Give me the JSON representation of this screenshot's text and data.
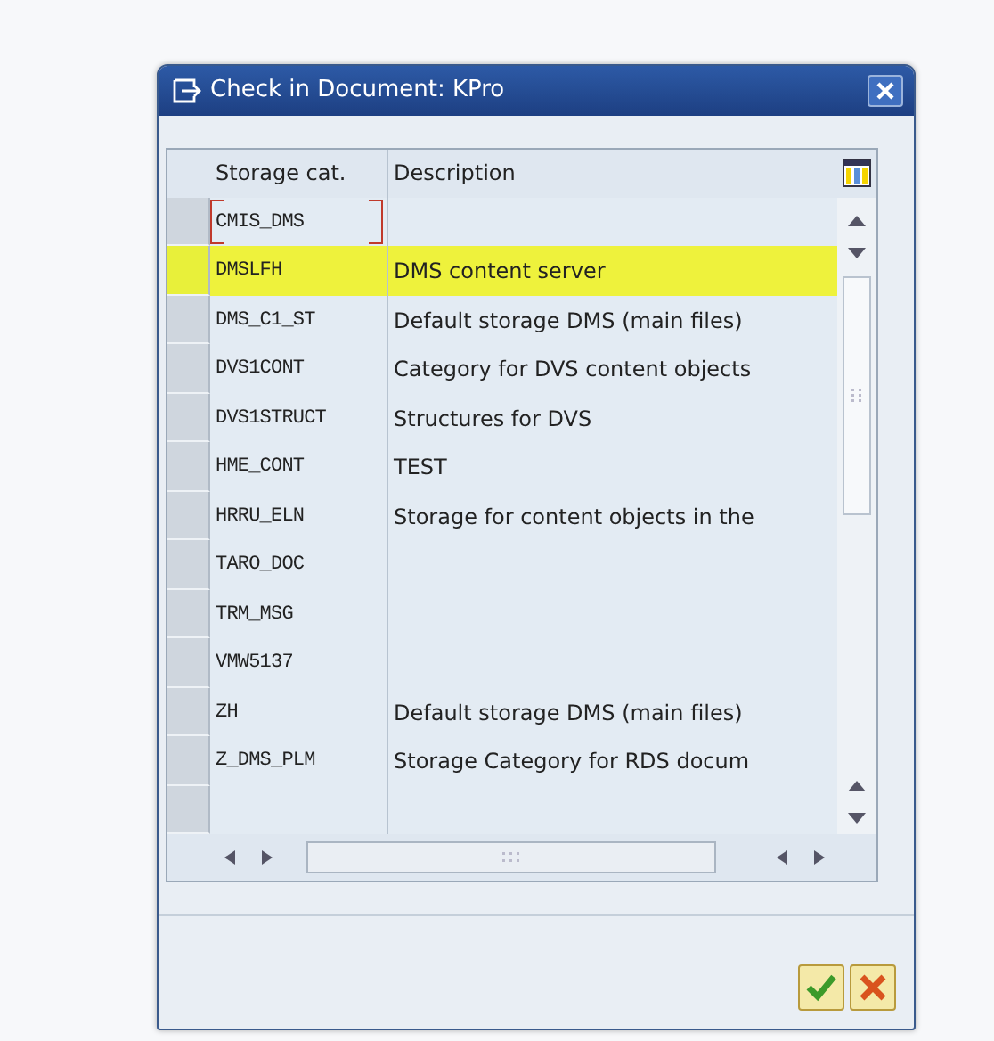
{
  "window": {
    "title": "Check in Document: KPro"
  },
  "table": {
    "columns": [
      "Storage cat.",
      "Description"
    ],
    "rows": [
      {
        "storage_cat": "CMIS_DMS",
        "description": "",
        "highlighted": false,
        "focused": true
      },
      {
        "storage_cat": "DMSLFH",
        "description": "DMS content server",
        "highlighted": true,
        "focused": false
      },
      {
        "storage_cat": "DMS_C1_ST",
        "description": "Default storage DMS (main files)",
        "highlighted": false,
        "focused": false
      },
      {
        "storage_cat": "DVS1CONT",
        "description": "Category for DVS content objects",
        "highlighted": false,
        "focused": false
      },
      {
        "storage_cat": "DVS1STRUCT",
        "description": "Structures for DVS",
        "highlighted": false,
        "focused": false
      },
      {
        "storage_cat": "HME_CONT",
        "description": "TEST",
        "highlighted": false,
        "focused": false
      },
      {
        "storage_cat": "HRRU_ELN",
        "description": "Storage for content objects in the",
        "highlighted": false,
        "focused": false
      },
      {
        "storage_cat": "TARO_DOC",
        "description": "",
        "highlighted": false,
        "focused": false
      },
      {
        "storage_cat": "TRM_MSG",
        "description": "",
        "highlighted": false,
        "focused": false
      },
      {
        "storage_cat": "VMW5137",
        "description": "",
        "highlighted": false,
        "focused": false
      },
      {
        "storage_cat": "ZH",
        "description": "Default storage DMS (main files)",
        "highlighted": false,
        "focused": false
      },
      {
        "storage_cat": "Z_DMS_PLM",
        "description": "Storage Category for RDS docum",
        "highlighted": false,
        "focused": false
      }
    ]
  }
}
